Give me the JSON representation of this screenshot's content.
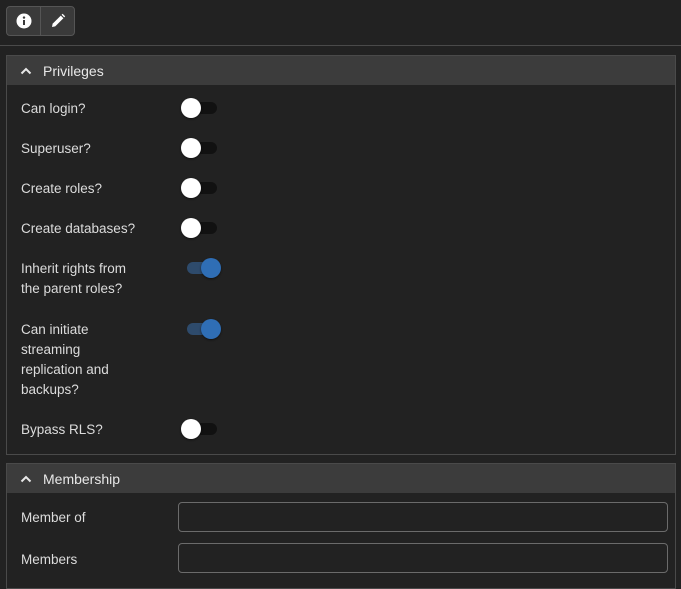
{
  "toolbar": {
    "info_icon": "info-circle-icon",
    "edit_icon": "pencil-icon"
  },
  "privileges": {
    "title": "Privileges",
    "items": [
      {
        "label": "Can login?",
        "checked": false
      },
      {
        "label": "Superuser?",
        "checked": false
      },
      {
        "label": "Create roles?",
        "checked": false
      },
      {
        "label": "Create databases?",
        "checked": false
      },
      {
        "label_lines": [
          "Inherit rights from",
          "the parent roles?"
        ],
        "checked": true
      },
      {
        "label_lines": [
          "Can initiate",
          "streaming",
          "replication and",
          "backups?"
        ],
        "checked": true
      },
      {
        "label": "Bypass RLS?",
        "checked": false
      }
    ]
  },
  "membership": {
    "title": "Membership",
    "member_of_label": "Member of",
    "member_of_value": "",
    "members_label": "Members",
    "members_value": ""
  },
  "colors": {
    "background": "#222222",
    "header": "#3c3c3c",
    "switch_on": "#2f6eb5",
    "switch_off_knob": "#ffffff"
  }
}
